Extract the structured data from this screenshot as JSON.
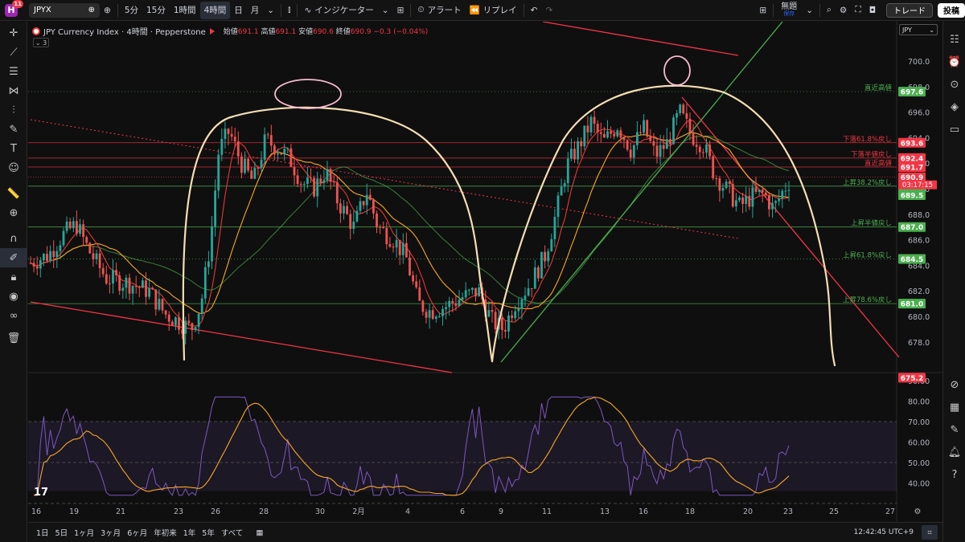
{
  "topbar": {
    "logo_letter": "H",
    "badge": "11",
    "symbol": "JPYX",
    "intervals": [
      "5分",
      "15分",
      "1時間",
      "4時間",
      "日",
      "月"
    ],
    "active_interval": "4時間",
    "indicators_label": "インジケーター",
    "alert_label": "アラート",
    "replay_label": "リプレイ",
    "layout_name": "無題",
    "layout_sub": "保存",
    "trade_label": "トレード",
    "post_label": "投稿"
  },
  "legend": {
    "title": "JPY Currency Index · 4時間 · Pepperstone",
    "open_label": "始値",
    "open": "691.1",
    "high_label": "高値",
    "high": "691.1",
    "low_label": "安値",
    "low": "690.6",
    "close_label": "終値",
    "close": "690.9",
    "change": "−0.3 (−0.04%)",
    "indicator_count": "3"
  },
  "currency_select": "JPY",
  "price_axis": {
    "ticks": [
      "700.0",
      "698.0",
      "696.0",
      "694.0",
      "692.0",
      "690.0",
      "688.0",
      "686.0",
      "684.0",
      "682.0",
      "680.0",
      "678.0"
    ],
    "rsi_ticks": [
      "90.00",
      "80.00",
      "70.00",
      "60.00",
      "50.00",
      "40.00"
    ]
  },
  "levels": [
    {
      "label": "直近高値",
      "value": "697.6",
      "color": "#4caf50"
    },
    {
      "label": "下落61.8%戻し",
      "value": "693.6",
      "color": "#f23645"
    },
    {
      "label": "下落半値戻し",
      "value": "692.4",
      "color": "#f23645"
    },
    {
      "label": "直近高値",
      "value": "691.7",
      "color": "#f23645"
    },
    {
      "label": "",
      "value": "690.9",
      "color": "#f23645"
    },
    {
      "label": "上昇38.2%戻し",
      "value": "690.2",
      "color": "#4caf50"
    },
    {
      "label": "",
      "value": "689.5",
      "color": "#4caf50"
    },
    {
      "label": "上昇半値戻し",
      "value": "687.0",
      "color": "#4caf50"
    },
    {
      "label": "上昇61.8%戻し",
      "value": "684.5",
      "color": "#4caf50"
    },
    {
      "label": "上昇78.6%戻し",
      "value": "681.0",
      "color": "#4caf50"
    },
    {
      "label": "",
      "value": "675.2",
      "color": "#f23645"
    }
  ],
  "countdown": "03:17:15",
  "time_axis": [
    "16",
    "19",
    "21",
    "23",
    "26",
    "28",
    "30",
    "2月",
    "4",
    "6",
    "9",
    "11",
    "13",
    "16",
    "18",
    "20",
    "23",
    "25",
    "27"
  ],
  "bottombar": {
    "ranges": [
      "1日",
      "5日",
      "1ヶ月",
      "3ヶ月",
      "6ヶ月",
      "年初来",
      "1年",
      "5年",
      "すべて"
    ],
    "clock": "12:42:45 UTC+9"
  },
  "colors": {
    "up": "#26a69a",
    "down": "#ef5350",
    "sma_fast": "#e53935",
    "sma_slow": "#f9a825",
    "sma_long": "#4caf50",
    "rsi": "#7e57c2",
    "rsi_ma": "#f9a825",
    "drawing": "#f5deb3"
  }
}
